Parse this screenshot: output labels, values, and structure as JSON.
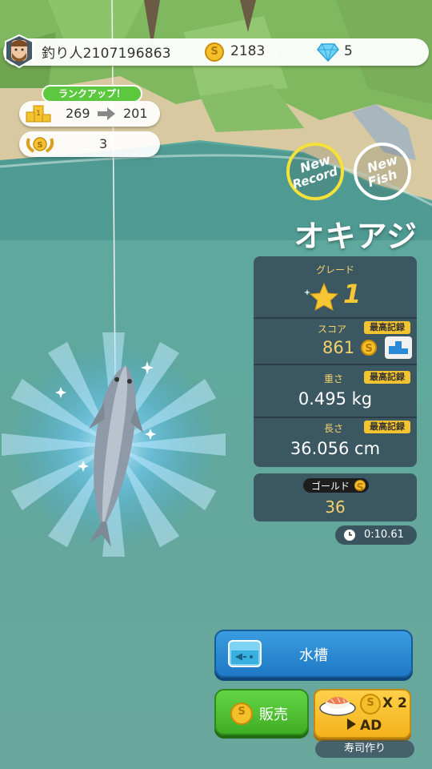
{
  "player": {
    "name": "釣り人2107196863",
    "coins": "2183",
    "gems": "5"
  },
  "rank": {
    "badge": "ランクアップ！",
    "from": "269",
    "to": "201",
    "laurel_value": "3"
  },
  "badges": {
    "new_record": [
      "New",
      "Record"
    ],
    "new_fish": [
      "New",
      "Fish"
    ]
  },
  "fish": {
    "name": "オキアジ"
  },
  "stats": {
    "grade_label": "グレード",
    "grade_value": "1",
    "score_label": "スコア",
    "best_label": "最高記録",
    "score_value": "861",
    "weight_label": "重さ",
    "weight_value": "0.495 kg",
    "length_label": "長さ",
    "length_value": "36.056 cm"
  },
  "gold": {
    "label": "ゴールド",
    "value": "36"
  },
  "timer": {
    "value": "0:10.61"
  },
  "buttons": {
    "tank": "水槽",
    "sell": "販売",
    "multiplier": "X 2",
    "ad": "AD",
    "sushi_label": "寿司作り"
  },
  "colors": {
    "accent_gold": "#f4c430",
    "grade_star": "#f6c634",
    "sell_green": "#4ec12f",
    "tank_blue": "#2a8ad6"
  }
}
